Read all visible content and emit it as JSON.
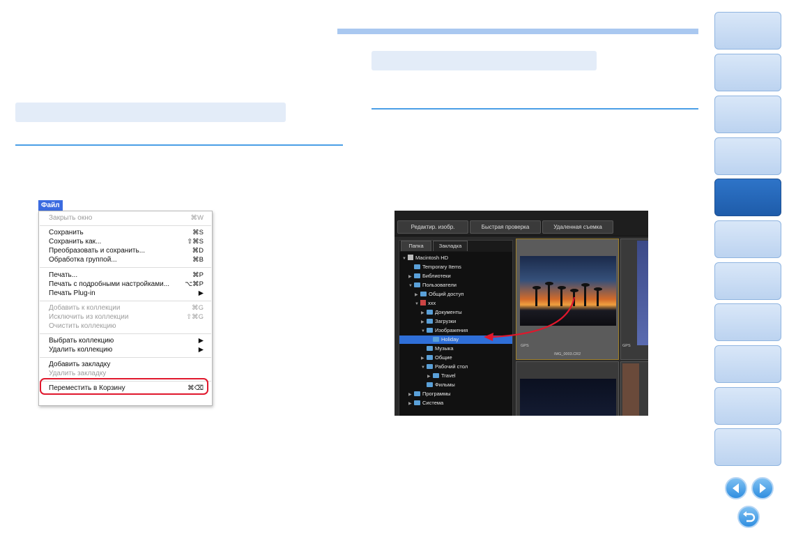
{
  "file_menu": {
    "title": "Файл",
    "items": [
      {
        "label": "Закрыть окно",
        "shortcut": "⌘W",
        "disabled": true
      },
      {
        "label": "Сохранить",
        "shortcut": "⌘S",
        "disabled": false
      },
      {
        "label": "Сохранить как...",
        "shortcut": "⇧⌘S",
        "disabled": false
      },
      {
        "label": "Преобразовать и сохранить...",
        "shortcut": "⌘D",
        "disabled": false
      },
      {
        "label": "Обработка группой...",
        "shortcut": "⌘B",
        "disabled": false
      },
      {
        "label": "Печать...",
        "shortcut": "⌘P",
        "disabled": false
      },
      {
        "label": "Печать с подробными настройками...",
        "shortcut": "⌥⌘P",
        "disabled": false
      },
      {
        "label": "Печать Plug-in",
        "shortcut": "▶",
        "disabled": false
      },
      {
        "label": "Добавить к коллекции",
        "shortcut": "⌘G",
        "disabled": true
      },
      {
        "label": "Исключить из коллекции",
        "shortcut": "⇧⌘G",
        "disabled": true
      },
      {
        "label": "Очистить коллекцию",
        "shortcut": "",
        "disabled": true
      },
      {
        "label": "Выбрать коллекцию",
        "shortcut": "▶",
        "disabled": false
      },
      {
        "label": "Удалить коллекцию",
        "shortcut": "▶",
        "disabled": false
      },
      {
        "label": "Добавить закладку",
        "shortcut": "",
        "disabled": false
      },
      {
        "label": "Удалить закладку",
        "shortcut": "",
        "disabled": true
      },
      {
        "label": "Переместить в Корзину",
        "shortcut": "⌘⌫",
        "disabled": false
      }
    ]
  },
  "dpp": {
    "toolbar": [
      "Редактир. изобр.",
      "Быстрая проверка",
      "Удаленная съемка"
    ],
    "tabs": [
      "Папка",
      "Закладка"
    ],
    "tree": [
      {
        "label": "Macintosh HD",
        "level": 0,
        "icon": "hd",
        "arrow": "▼"
      },
      {
        "label": "Temporary Items",
        "level": 1,
        "icon": "folder",
        "arrow": ""
      },
      {
        "label": "Библиотеки",
        "level": 1,
        "icon": "folder",
        "arrow": "▶"
      },
      {
        "label": "Пользователи",
        "level": 1,
        "icon": "folder",
        "arrow": "▼"
      },
      {
        "label": "Общий доступ",
        "level": 2,
        "icon": "folder",
        "arrow": "▶"
      },
      {
        "label": "xxx",
        "level": 2,
        "icon": "home",
        "arrow": "▼"
      },
      {
        "label": "Документы",
        "level": 3,
        "icon": "folder",
        "arrow": "▶"
      },
      {
        "label": "Загрузки",
        "level": 3,
        "icon": "folder",
        "arrow": "▶"
      },
      {
        "label": "Изображения",
        "level": 3,
        "icon": "folder",
        "arrow": "▼"
      },
      {
        "label": "Holiday",
        "level": 4,
        "icon": "folder",
        "arrow": "",
        "selected": true
      },
      {
        "label": "Музыка",
        "level": 3,
        "icon": "folder",
        "arrow": ""
      },
      {
        "label": "Общие",
        "level": 3,
        "icon": "folder",
        "arrow": "▶"
      },
      {
        "label": "Рабочий стол",
        "level": 3,
        "icon": "folder",
        "arrow": "▼"
      },
      {
        "label": "Travel",
        "level": 4,
        "icon": "folder",
        "arrow": "▶"
      },
      {
        "label": "Фильмы",
        "level": 3,
        "icon": "folder",
        "arrow": ""
      },
      {
        "label": "Программы",
        "level": 1,
        "icon": "folder",
        "arrow": "▶"
      },
      {
        "label": "Система",
        "level": 1,
        "icon": "folder",
        "arrow": "▶"
      }
    ],
    "thumb1_filename": "IMG_0003.CR2",
    "gps_label": "GPS"
  },
  "colors": {
    "accent_line": "#4a9ee6",
    "highlight_box": "#e0172c",
    "nav_active": "#1e5caa"
  },
  "nav_icons": [
    "prev-page-icon",
    "next-page-icon",
    "return-icon"
  ]
}
